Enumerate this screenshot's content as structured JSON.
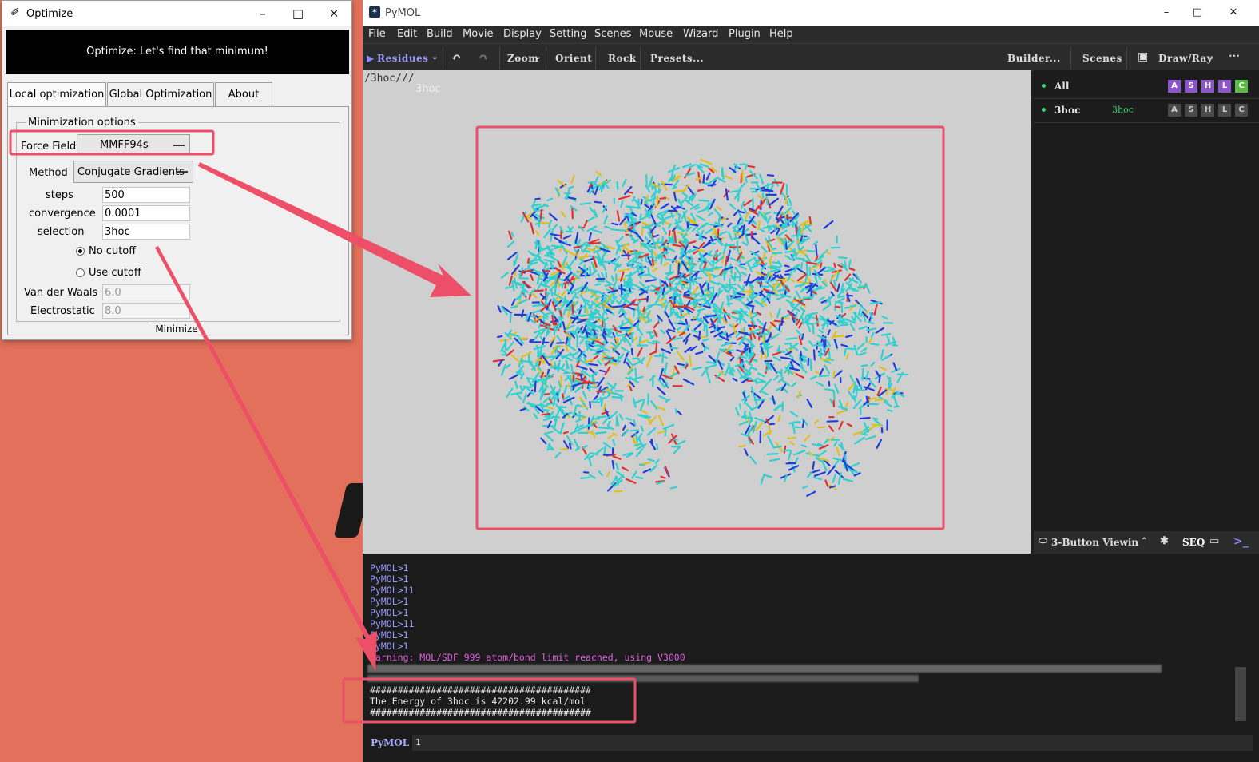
{
  "optimize": {
    "title": "Optimize",
    "banner": "Optimize: Let's find that minimum!",
    "tabs": [
      "Local optimization",
      "Global Optimization",
      "About"
    ],
    "group_label": "Minimization options",
    "force_field_label": "Force Field",
    "force_field_value": "MMFF94s",
    "method_label": "Method",
    "method_value": "Conjugate Gradients",
    "steps_label": "steps",
    "steps_value": "500",
    "convergence_label": "convergence",
    "convergence_value": "0.0001",
    "selection_label": "selection",
    "selection_value": "3hoc",
    "no_cutoff_label": "No cutoff",
    "use_cutoff_label": "Use cutoff",
    "cutoff_selected": "No cutoff",
    "vdw_label": "Van der Waals",
    "vdw_value": "6.0",
    "elec_label": "Electrostatic",
    "elec_value": "8.0",
    "minimize_label": "Minimize"
  },
  "pymol": {
    "title": "PyMOL",
    "menu": [
      "File",
      "Edit",
      "Build",
      "Movie",
      "Display",
      "Setting",
      "Scenes",
      "Mouse",
      "Wizard",
      "Plugin",
      "Help"
    ],
    "toolbar": {
      "residues": "Residues",
      "zoom": "Zoom",
      "orient": "Orient",
      "rock": "Rock",
      "presets": "Presets...",
      "builder": "Builder...",
      "scenes": "Scenes",
      "draw_ray": "Draw/Ray"
    },
    "viewport": {
      "path": "/3hoc///",
      "object_label": "3hoc"
    },
    "objects": [
      {
        "name": "All",
        "sub": ""
      },
      {
        "name": "3hoc",
        "sub": "3hoc"
      }
    ],
    "ashlc": [
      "A",
      "S",
      "H",
      "L",
      "C"
    ],
    "ashlc_colors": {
      "A": "#8a56c8",
      "S": "#8a56c8",
      "H": "#8a56c8",
      "L": "#8a56c8",
      "C": "#5cb84a"
    },
    "bottombar": {
      "mouse_mode": "3-Button Viewin",
      "seq": "SEQ"
    },
    "console_lines": [
      "PyMOL>1",
      "PyMOL>1",
      "PyMOL>11",
      "PyMOL>1",
      "PyMOL>1",
      "PyMOL>11",
      "PyMOL>1",
      "PyMOL>1"
    ],
    "warning": "Warning: MOL/SDF 999 atom/bond limit reached, using V3000",
    "energy_sep": "########################################",
    "energy_text": "The Energy of 3hoc is 42202.99 kcal/mol",
    "prompt": "PyMOL >",
    "command_value": "1",
    "colors": {
      "prompt": "#9a9aff",
      "warning": "#e060e0",
      "highlight": "#ec4f67"
    }
  }
}
